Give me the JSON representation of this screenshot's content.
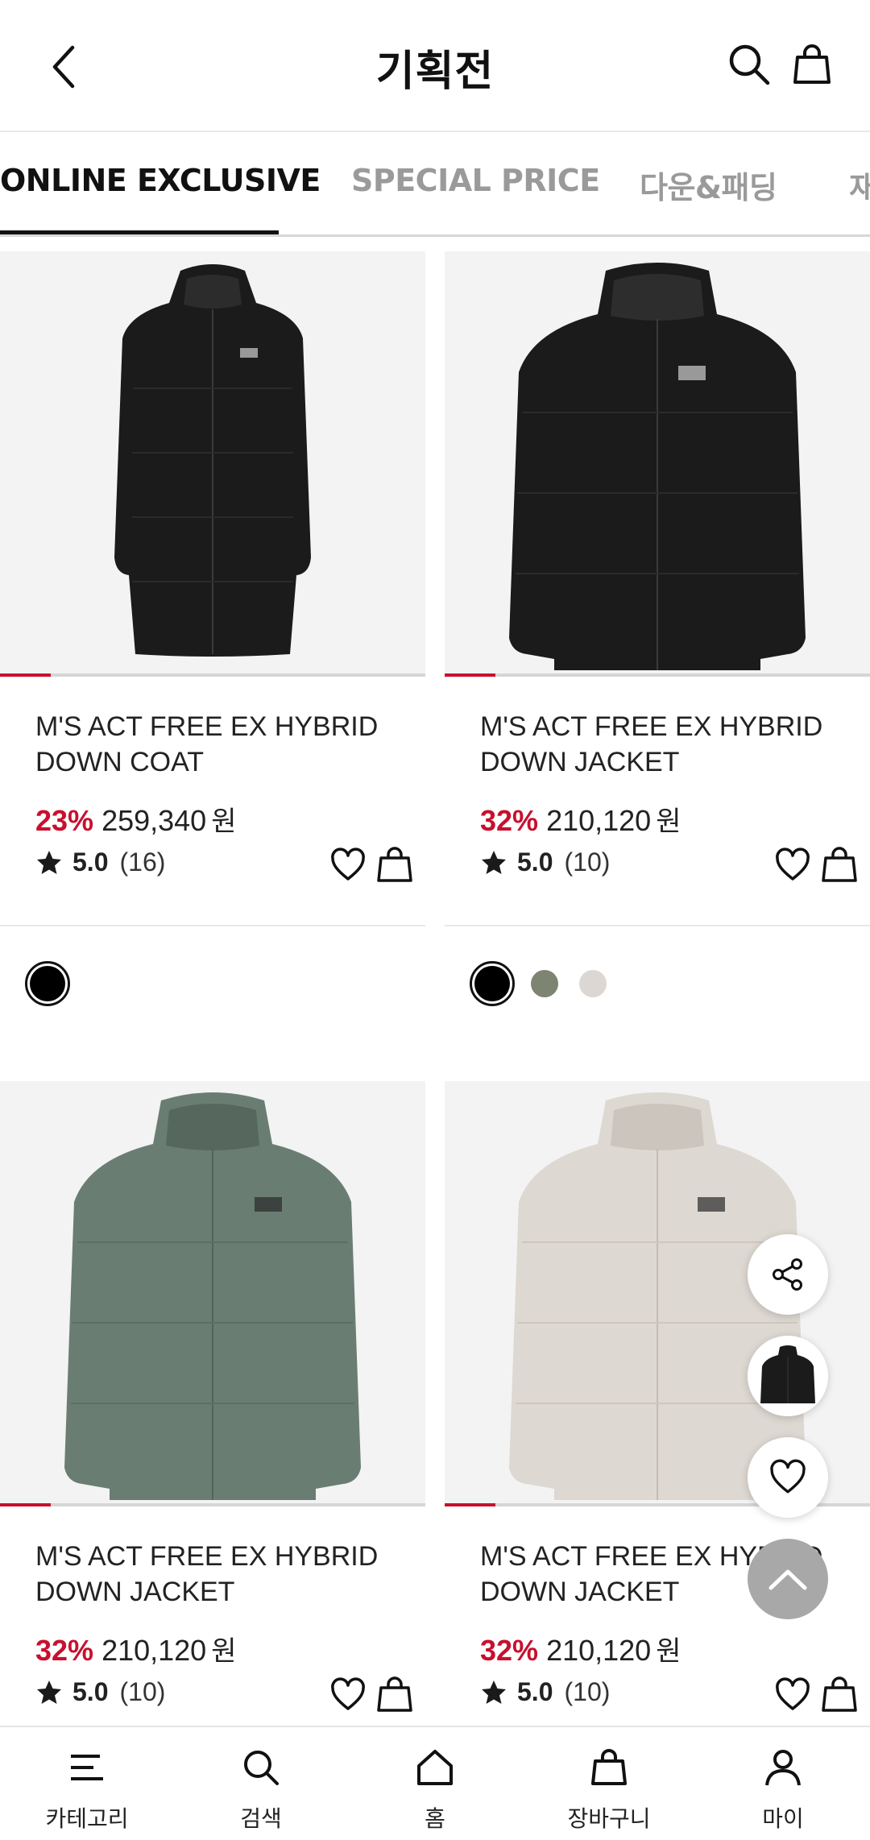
{
  "header": {
    "title": "기획전",
    "back_icon": "chevron-left-icon",
    "search_icon": "search-icon",
    "bag_icon": "shopping-bag-icon"
  },
  "tabs": [
    {
      "label": "ONLINE EXCLUSIVE",
      "active": true
    },
    {
      "label": "SPECIAL PRICE",
      "active": false
    },
    {
      "label": "다운&패딩",
      "active": false
    },
    {
      "label": "재",
      "active": false
    }
  ],
  "colors": {
    "accent": "#c8102e",
    "text": "#222222",
    "tab_inactive": "#9a9a9a"
  },
  "products": [
    {
      "name": "M'S ACT FREE EX HYBRID DOWN COAT",
      "discount": "23%",
      "price": "259,340",
      "currency": "원",
      "rating": "5.0",
      "reviews": "(16)",
      "image_color": "#1b1b1b",
      "image_progress": 0.12,
      "swatches": [
        "#000000"
      ],
      "selected_swatch": 0
    },
    {
      "name": "M'S ACT FREE EX HYBRID DOWN JACKET",
      "discount": "32%",
      "price": "210,120",
      "currency": "원",
      "rating": "5.0",
      "reviews": "(10)",
      "image_color": "#1b1b1b",
      "image_progress": 0.12,
      "swatches": [
        "#000000",
        "#7d8572",
        "#dcd7d3"
      ],
      "selected_swatch": 0
    },
    {
      "name": "M'S ACT FREE EX HYBRID DOWN JACKET",
      "discount": "32%",
      "price": "210,120",
      "currency": "원",
      "rating": "5.0",
      "reviews": "(10)",
      "image_color": "#6a7d72",
      "image_progress": 0.12
    },
    {
      "name": "M'S ACT FREE EX HYBRID DOWN JACKET",
      "discount": "32%",
      "price": "210,120",
      "currency": "원",
      "rating": "5.0",
      "reviews": "(10)",
      "image_color": "#ddd8d1",
      "image_progress": 0.12
    }
  ],
  "floating": {
    "share_icon": "share-icon",
    "recent_icon": "recent-product-thumbnail",
    "wishlist_icon": "heart-icon",
    "top_icon": "chevron-up-icon"
  },
  "bottom_nav": [
    {
      "label": "카테고리",
      "icon": "menu-icon"
    },
    {
      "label": "검색",
      "icon": "search-icon"
    },
    {
      "label": "홈",
      "icon": "home-icon"
    },
    {
      "label": "장바구니",
      "icon": "shopping-bag-icon"
    },
    {
      "label": "마이",
      "icon": "person-icon"
    }
  ]
}
